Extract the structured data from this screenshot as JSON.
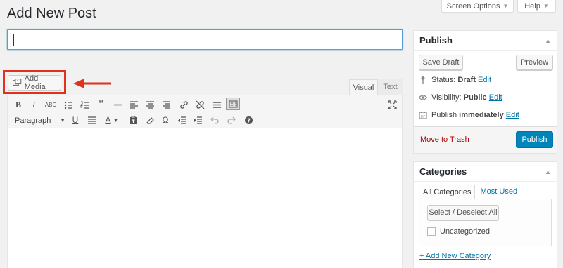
{
  "header": {
    "title": "Add New Post",
    "screen_options": "Screen Options",
    "help": "Help"
  },
  "post": {
    "title_value": ""
  },
  "media": {
    "add_media": "Add Media"
  },
  "editor": {
    "tab_visual": "Visual",
    "tab_text": "Text",
    "format_select": "Paragraph",
    "toolbar_icons": [
      "bold-icon",
      "italic-icon",
      "strikethrough-icon",
      "bulleted-list-icon",
      "numbered-list-icon",
      "blockquote-icon",
      "horizontal-line-icon",
      "align-left-icon",
      "align-center-icon",
      "align-right-icon",
      "insert-link-icon",
      "remove-link-icon",
      "read-more-icon",
      "toolbar-toggle-icon",
      "fullscreen-icon",
      "underline-icon",
      "justify-icon",
      "text-color-icon",
      "paste-as-text-icon",
      "clear-formatting-icon",
      "special-character-icon",
      "outdent-icon",
      "indent-icon",
      "undo-icon",
      "redo-icon",
      "help-icon"
    ]
  },
  "publish": {
    "title": "Publish",
    "save_draft": "Save Draft",
    "preview": "Preview",
    "status_label": "Status:",
    "status_value": "Draft",
    "visibility_label": "Visibility:",
    "visibility_value": "Public",
    "schedule_label": "Publish",
    "schedule_value": "immediately",
    "edit": "Edit",
    "trash": "Move to Trash",
    "publish_button": "Publish"
  },
  "categories": {
    "title": "Categories",
    "tab_all": "All Categories",
    "tab_used": "Most Used",
    "select_all": "Select / Deselect All",
    "items": [
      {
        "label": "Uncategorized",
        "checked": false
      }
    ],
    "add_new": "+ Add New Category"
  },
  "colors": {
    "accent": "#0085ba",
    "link": "#0073aa",
    "highlight": "#e0301e",
    "trash": "#aa0000"
  }
}
